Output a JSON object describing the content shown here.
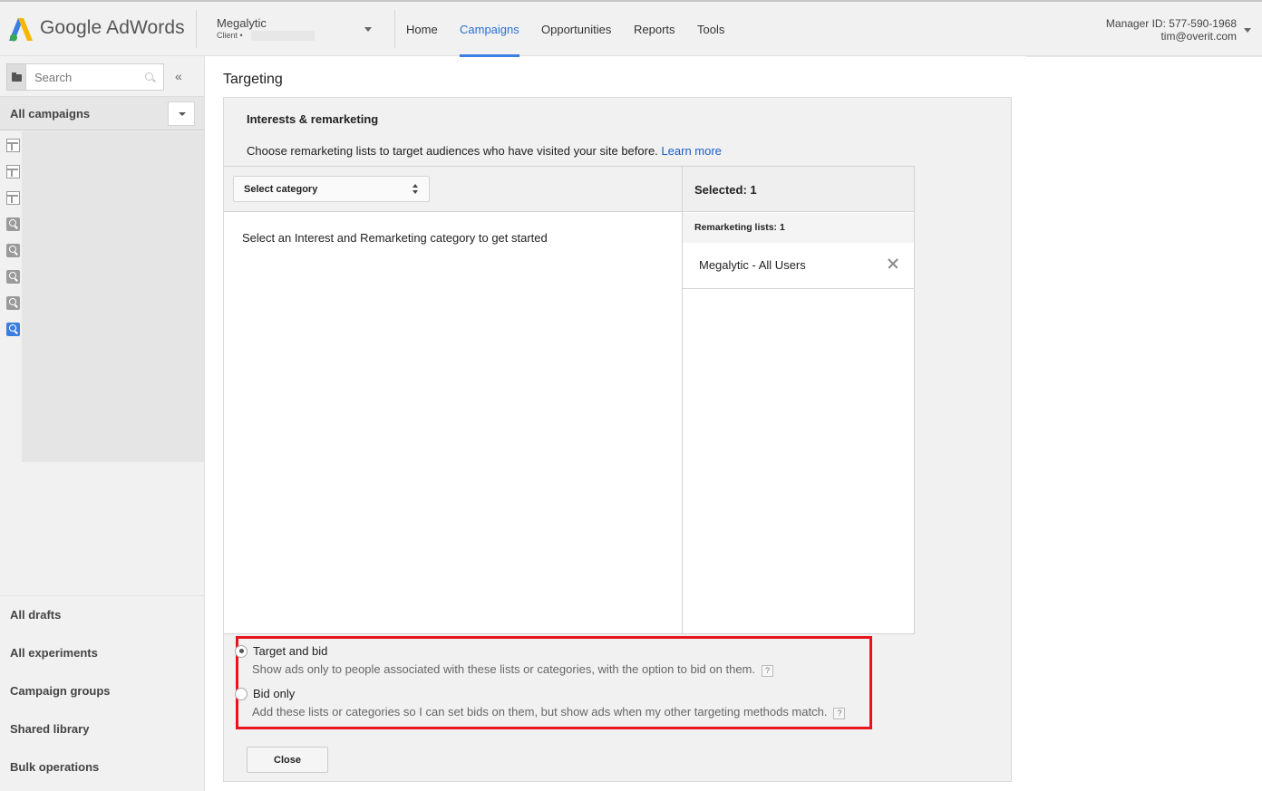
{
  "header": {
    "brand": "Google AdWords",
    "account": {
      "name": "Megalytic",
      "sub": "Client •"
    },
    "nav": [
      {
        "label": "Home",
        "active": false
      },
      {
        "label": "Campaigns",
        "active": true
      },
      {
        "label": "Opportunities",
        "active": false
      },
      {
        "label": "Reports",
        "active": false
      },
      {
        "label": "Tools",
        "active": false
      }
    ],
    "manager": {
      "id_label": "Manager ID: 577-590-1968",
      "email": "tim@overit.com"
    }
  },
  "sidebar": {
    "search_placeholder": "Search",
    "collapse_icon": "«",
    "all_campaigns": "All campaigns",
    "tree_icons": [
      "grid-icon",
      "grid-icon",
      "grid-icon",
      "search-icon",
      "search-icon",
      "search-icon",
      "search-icon",
      "search-icon-active"
    ],
    "links": [
      {
        "label": "All drafts"
      },
      {
        "label": "All experiments"
      },
      {
        "label": "Campaign groups"
      },
      {
        "label": "Shared library"
      },
      {
        "label": "Bulk operations"
      }
    ]
  },
  "main": {
    "title": "Targeting",
    "section_title": "Interests & remarketing",
    "description": "Choose remarketing lists to target audiences who have visited your site before.",
    "learn_more": "Learn more",
    "category_select": "Select category",
    "empty_message": "Select an Interest and Remarketing category to get started",
    "selected_header": "Selected: 1",
    "remarketing_header": "Remarketing lists: 1",
    "selected_items": [
      {
        "label": "Megalytic - All Users"
      }
    ],
    "options": [
      {
        "label": "Target and bid",
        "checked": true,
        "description": "Show ads only to people associated with these lists or categories, with the option to bid on them."
      },
      {
        "label": "Bid only",
        "checked": false,
        "description": "Add these lists or categories so I can set bids on them, but show ads when my other targeting methods match."
      }
    ],
    "help_glyph": "?",
    "close_label": "Close"
  },
  "colors": {
    "accent": "#3b7ee1",
    "link": "#1a5fc8",
    "highlight": "#e8141b",
    "sidebar_bg": "#f1f1f1"
  }
}
